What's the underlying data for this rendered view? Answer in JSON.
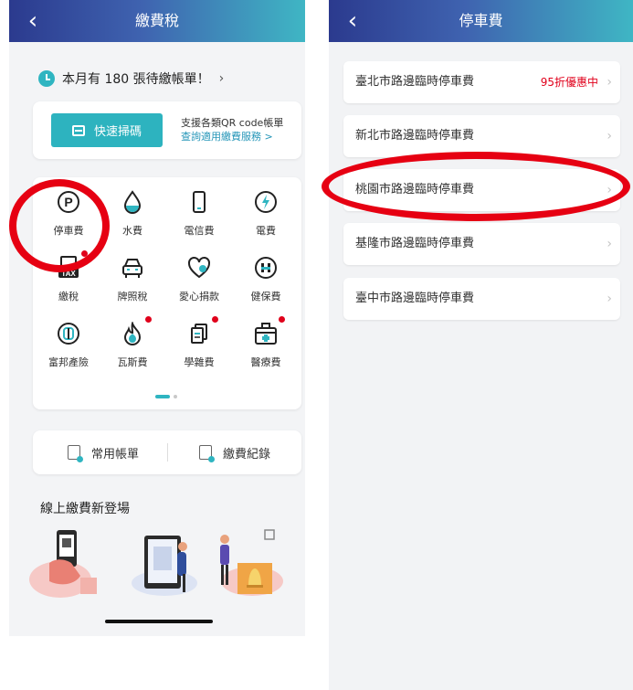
{
  "left_screen": {
    "header": {
      "back_icon": "chevron-left-icon",
      "title": "繳費稅"
    },
    "notice": {
      "text": "本月有 180 張待繳帳單！",
      "chevron": "›"
    },
    "scan": {
      "button_label": "快速掃碼",
      "info_line1": "支援各類QR code帳單",
      "info_link": "查詢適用繳費服務 >"
    },
    "services": [
      {
        "label": "停車費",
        "icon": "parking-icon",
        "dot": false
      },
      {
        "label": "水費",
        "icon": "water-drop-icon",
        "dot": false
      },
      {
        "label": "電信費",
        "icon": "phone-icon",
        "dot": false
      },
      {
        "label": "電費",
        "icon": "lightning-icon",
        "dot": false
      },
      {
        "label": "繳稅",
        "icon": "tax-icon",
        "dot": true
      },
      {
        "label": "牌照稅",
        "icon": "car-icon",
        "dot": false
      },
      {
        "label": "愛心捐款",
        "icon": "heart-icon",
        "dot": false
      },
      {
        "label": "健保費",
        "icon": "health-insurance-icon",
        "dot": false
      },
      {
        "label": "富邦產險",
        "icon": "fubon-insurance-icon",
        "dot": false
      },
      {
        "label": "瓦斯費",
        "icon": "flame-icon",
        "dot": true
      },
      {
        "label": "學雜費",
        "icon": "tuition-icon",
        "dot": true
      },
      {
        "label": "醫療費",
        "icon": "medical-kit-icon",
        "dot": true
      }
    ],
    "quick": {
      "common_bills": "常用帳單",
      "payment_records": "繳費紀錄"
    },
    "promo_title": "線上繳費新登場",
    "colors": {
      "accent": "#2db3bf",
      "notice_dot": "#e0001b"
    }
  },
  "right_screen": {
    "header": {
      "back_icon": "chevron-left-icon",
      "title": "停車費"
    },
    "items": [
      {
        "label": "臺北市路邊臨時停車費",
        "badge": "95折優惠中"
      },
      {
        "label": "新北市路邊臨時停車費",
        "badge": ""
      },
      {
        "label": "桃園市路邊臨時停車費",
        "badge": ""
      },
      {
        "label": "基隆市路邊臨時停車費",
        "badge": ""
      },
      {
        "label": "臺中市路邊臨時停車費",
        "badge": ""
      }
    ],
    "highlight_color": "#e60012"
  }
}
